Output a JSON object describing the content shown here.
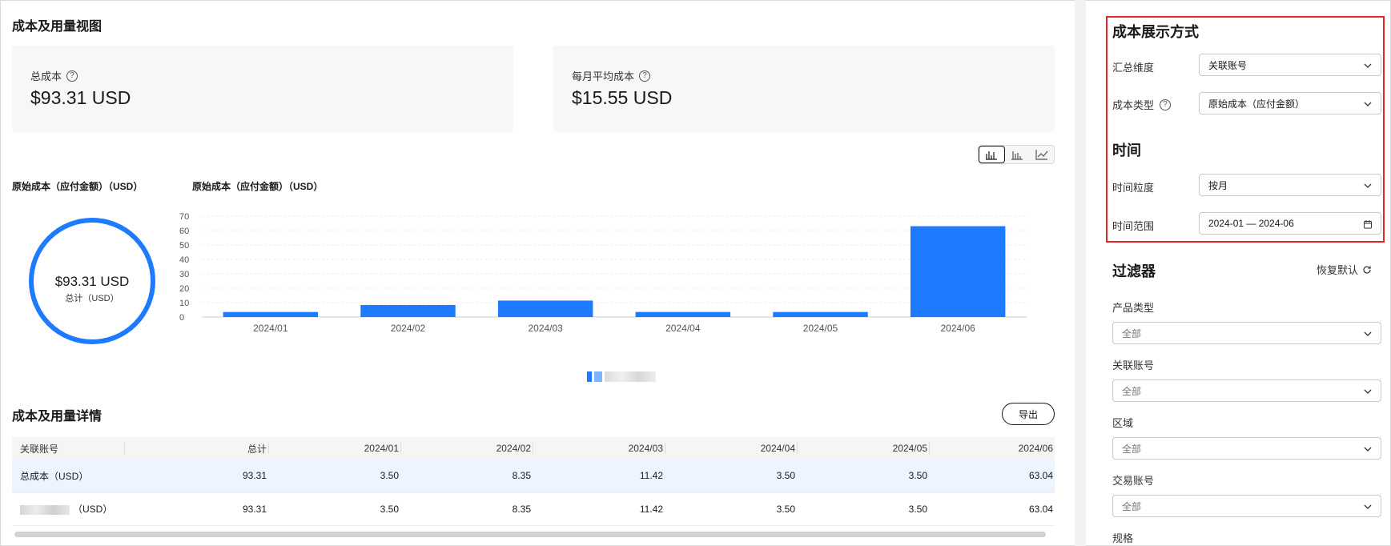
{
  "main": {
    "title": "成本及用量视图",
    "cards": {
      "total_label": "总成本",
      "total_value": "$93.31 USD",
      "monthly_label": "每月平均成本",
      "monthly_value": "$15.55 USD"
    },
    "view_icons": [
      "bar-stacked-icon",
      "bar-grouped-icon",
      "line-chart-icon"
    ],
    "donut": {
      "header": "原始成本（应付金额）（USD）",
      "value": "$93.31 USD",
      "label": "总计（USD）"
    },
    "chart_header": "原始成本（应付金额）（USD）",
    "detail_title": "成本及用量详情",
    "export_label": "导出",
    "table": {
      "columns": [
        "关联账号",
        "总计",
        "2024/01",
        "2024/02",
        "2024/03",
        "2024/04",
        "2024/05",
        "2024/06"
      ],
      "rows": [
        [
          "总成本（USD）",
          "93.31",
          "3.50",
          "8.35",
          "11.42",
          "3.50",
          "3.50",
          "63.04"
        ],
        [
          "（USD）",
          "93.31",
          "3.50",
          "8.35",
          "11.42",
          "3.50",
          "3.50",
          "63.04"
        ]
      ]
    }
  },
  "chart_data": {
    "type": "bar",
    "title": "原始成本（应付金额）（USD）",
    "categories": [
      "2024/01",
      "2024/02",
      "2024/03",
      "2024/04",
      "2024/05",
      "2024/06"
    ],
    "values": [
      3.5,
      8.35,
      11.42,
      3.5,
      3.5,
      63.04
    ],
    "ylim": [
      0,
      70
    ],
    "yticks": [
      0,
      10,
      20,
      30,
      40,
      50,
      60,
      70
    ],
    "grid": true,
    "bar_color": "#1e7bff"
  },
  "sidebar": {
    "display_title": "成本展示方式",
    "summary_label": "汇总维度",
    "summary_value": "关联账号",
    "cost_type_label": "成本类型",
    "cost_type_value": "原始成本（应付金额）",
    "time_title": "时间",
    "granularity_label": "时间粒度",
    "granularity_value": "按月",
    "range_label": "时间范围",
    "range_value": "2024-01 — 2024-06",
    "filter_title": "过滤器",
    "reset_label": "恢复默认",
    "filters": [
      {
        "label": "产品类型",
        "value": "全部"
      },
      {
        "label": "关联账号",
        "value": "全部"
      },
      {
        "label": "区域",
        "value": "全部"
      },
      {
        "label": "交易账号",
        "value": "全部"
      },
      {
        "label": "规格",
        "value": ""
      }
    ],
    "highlight_color": "#e5262b"
  }
}
